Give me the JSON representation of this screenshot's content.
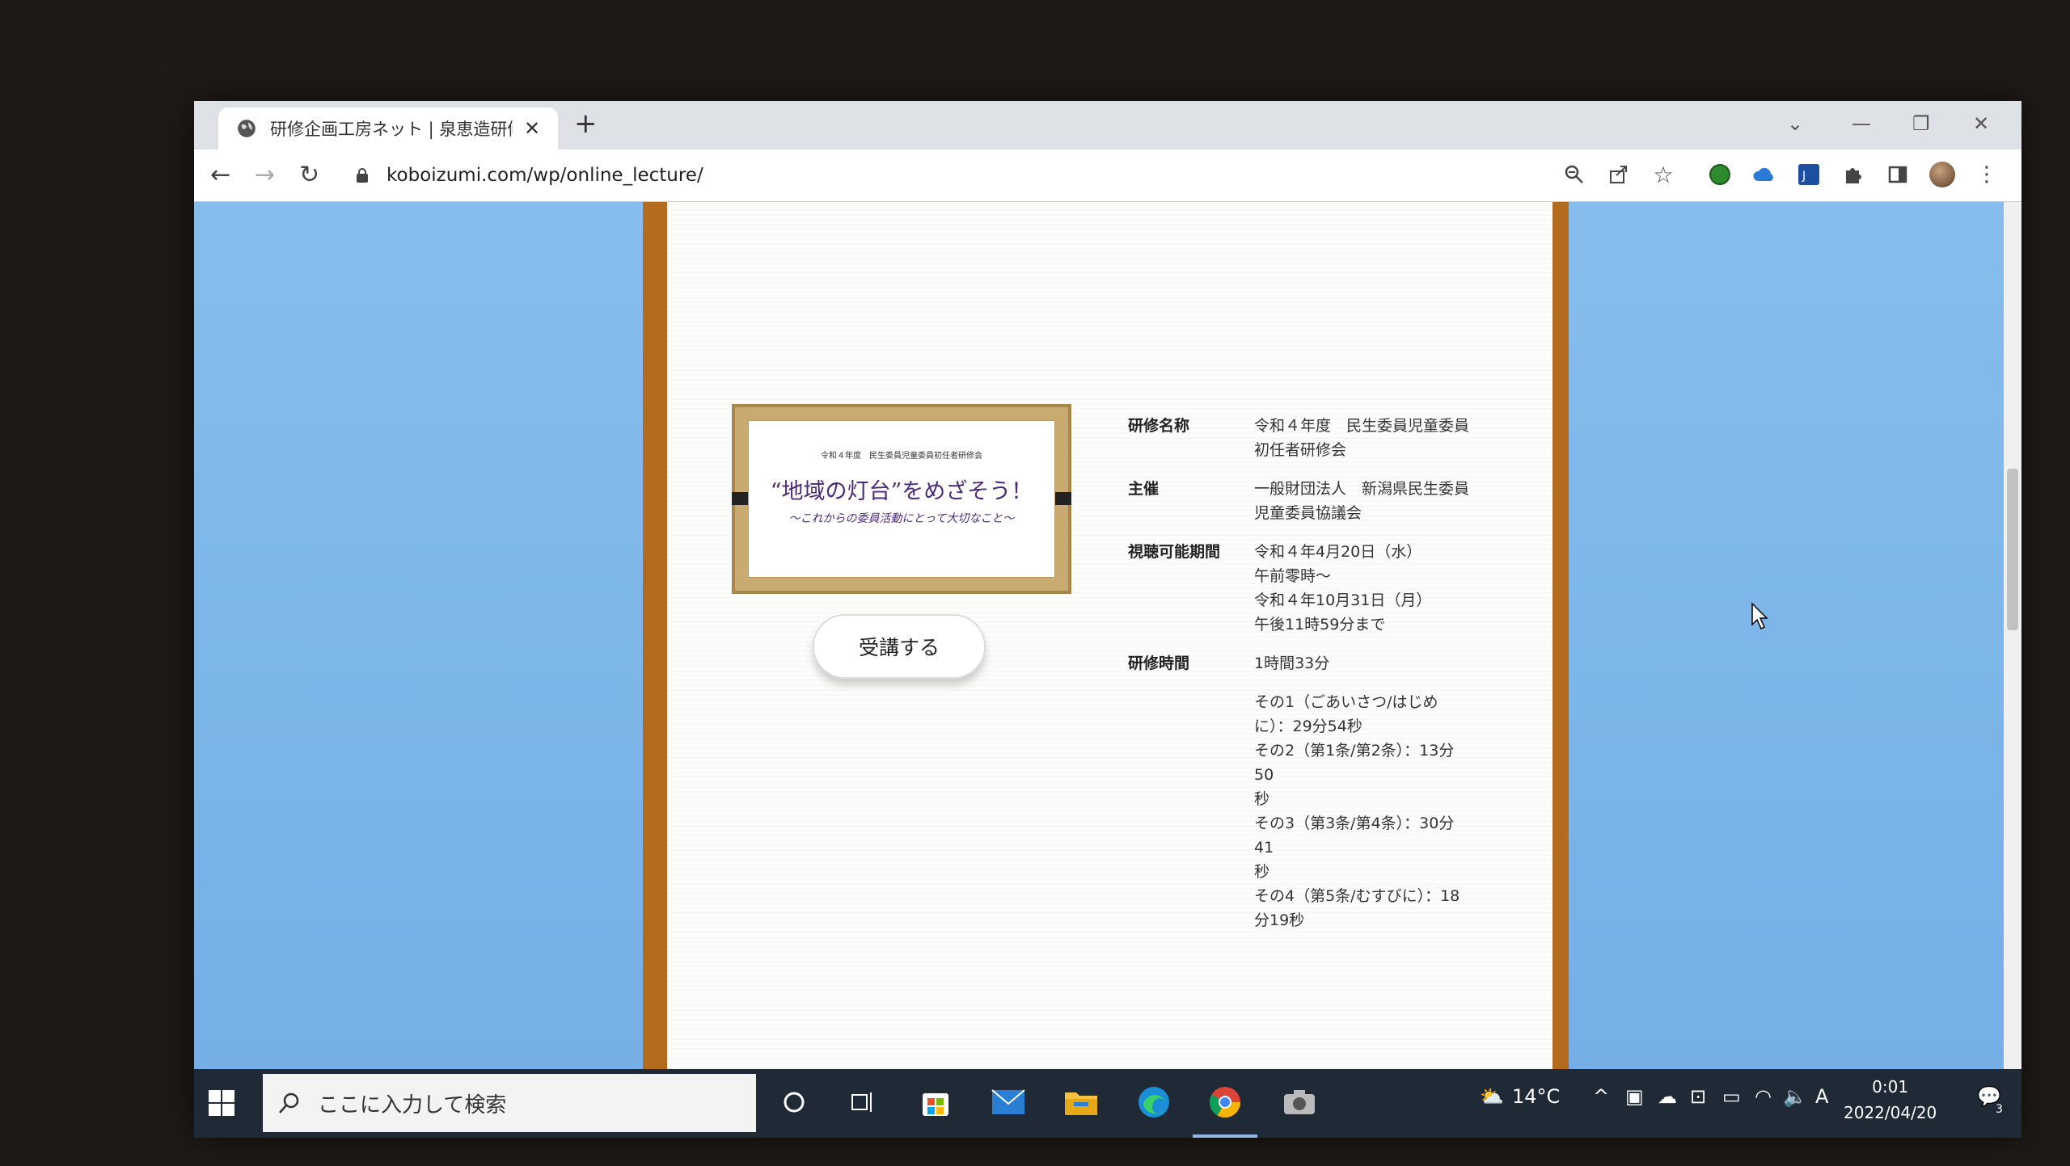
{
  "browser": {
    "tab_title": "研修企画工房ネット | 泉恵造研修",
    "new_tab": "+",
    "url": "koboizumi.com/wp/online_lecture/"
  },
  "frame": {
    "top_text": "令和４年度　民生委員児童委員初任者研修会",
    "title": "“地域の灯台”をめざそう！",
    "subtitle": "〜これからの委員活動にとって大切なこと〜"
  },
  "enroll_button": "受講する",
  "info": {
    "name_label": "研修名称",
    "name_value": [
      "令和４年度　民生委員児童委員",
      "初任者研修会"
    ],
    "host_label": "主催",
    "host_value": [
      "一般財団法人　新潟県民生委員",
      "児童委員協議会"
    ],
    "period_label": "視聴可能期間",
    "period_value": [
      "令和４年4月20日（水）",
      "午前零時～",
      "令和４年10月31日（月）",
      "午後11時59分まで"
    ],
    "duration_label": "研修時間",
    "duration_value": "1時間33分",
    "parts": [
      "その1（ごあいさつ/はじめ",
      "に）：29分54秒",
      "その2（第1条/第2条）：13分50",
      "秒",
      "その3（第3条/第4条）：30分41",
      "秒",
      "その4（第5条/むすびに）：18",
      "分19秒"
    ]
  },
  "taskbar": {
    "search_placeholder": "ここに入力して検索",
    "weather": "14°C",
    "time": "0:01",
    "date": "2022/04/20",
    "ime": "A",
    "notifications": "3"
  }
}
